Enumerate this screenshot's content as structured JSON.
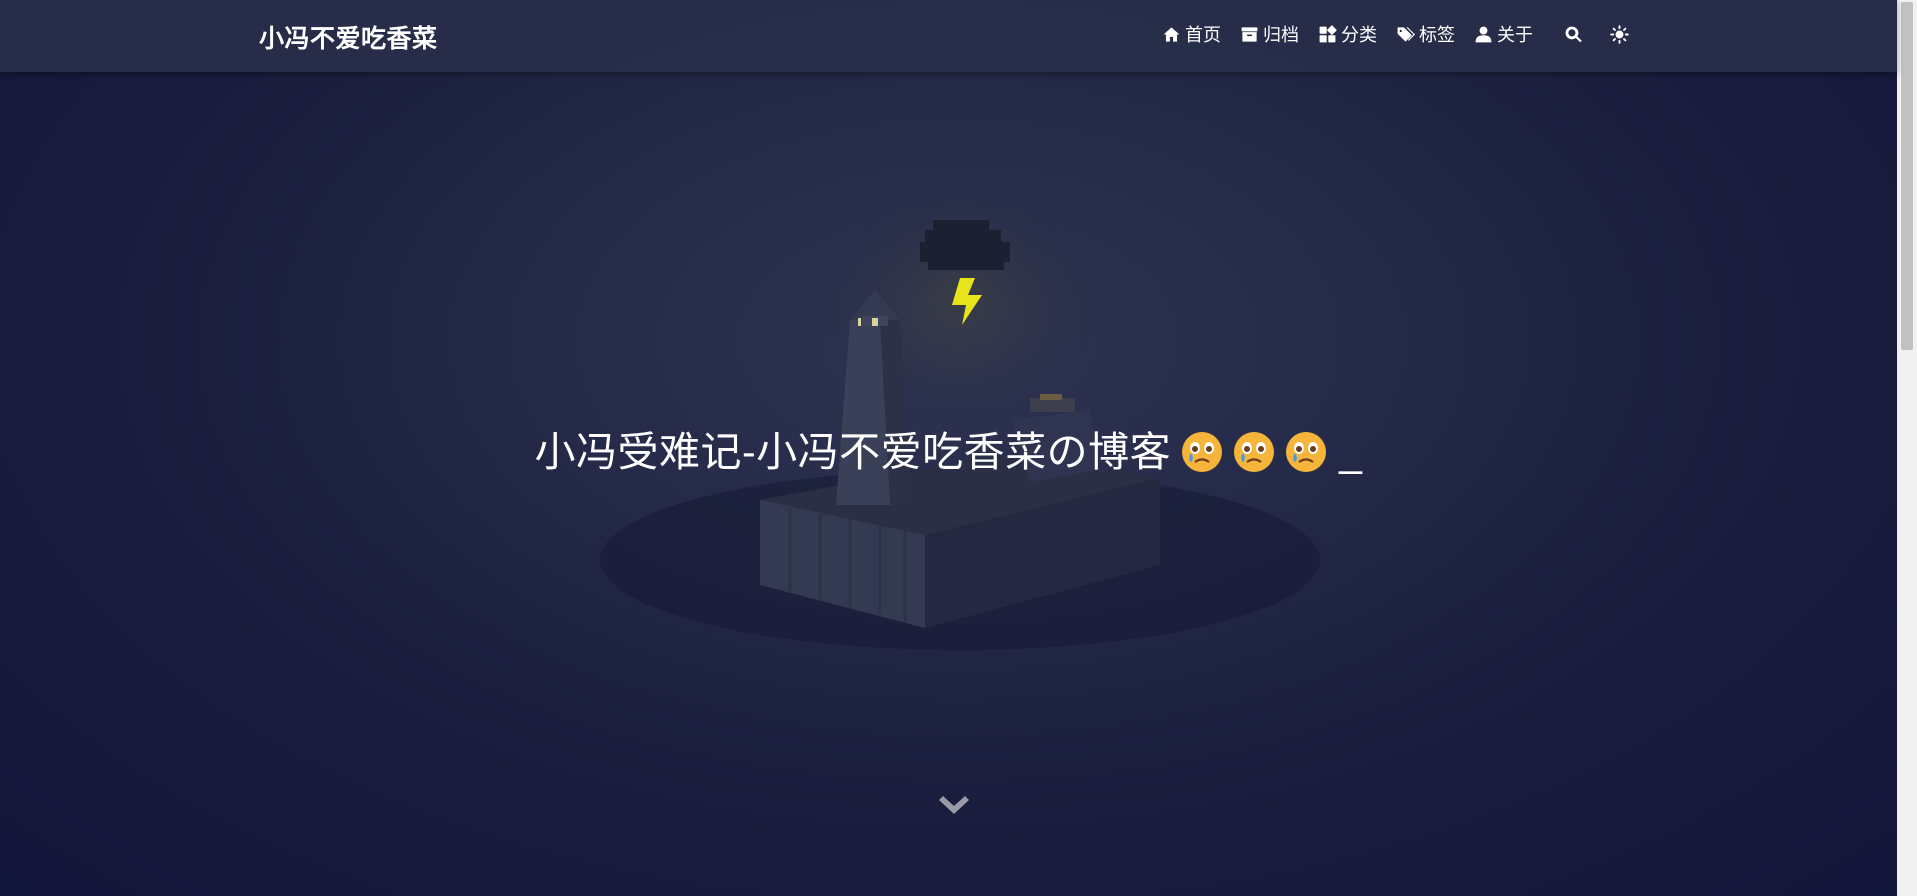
{
  "header": {
    "brand": "小冯不爱吃香菜",
    "nav": [
      {
        "label": "首页",
        "icon": "home-icon"
      },
      {
        "label": "归档",
        "icon": "archive-icon"
      },
      {
        "label": "分类",
        "icon": "category-icon"
      },
      {
        "label": "标签",
        "icon": "tags-icon"
      },
      {
        "label": "关于",
        "icon": "user-icon"
      }
    ],
    "search_icon": "search-icon",
    "theme_icon": "sun-icon"
  },
  "hero": {
    "title": "小冯受难记-小冯不爱吃香菜の博客",
    "emoji_icon": "crying-face-emoji",
    "emoji_count": 3,
    "cursor": "_",
    "scroll_icon": "chevron-down-icon"
  },
  "colors": {
    "navbar": "#282f4a",
    "background_top": "#2e3450",
    "background_bottom": "#12153a",
    "lightning": "#e8e41c",
    "emoji_face": "#f5b43a"
  }
}
